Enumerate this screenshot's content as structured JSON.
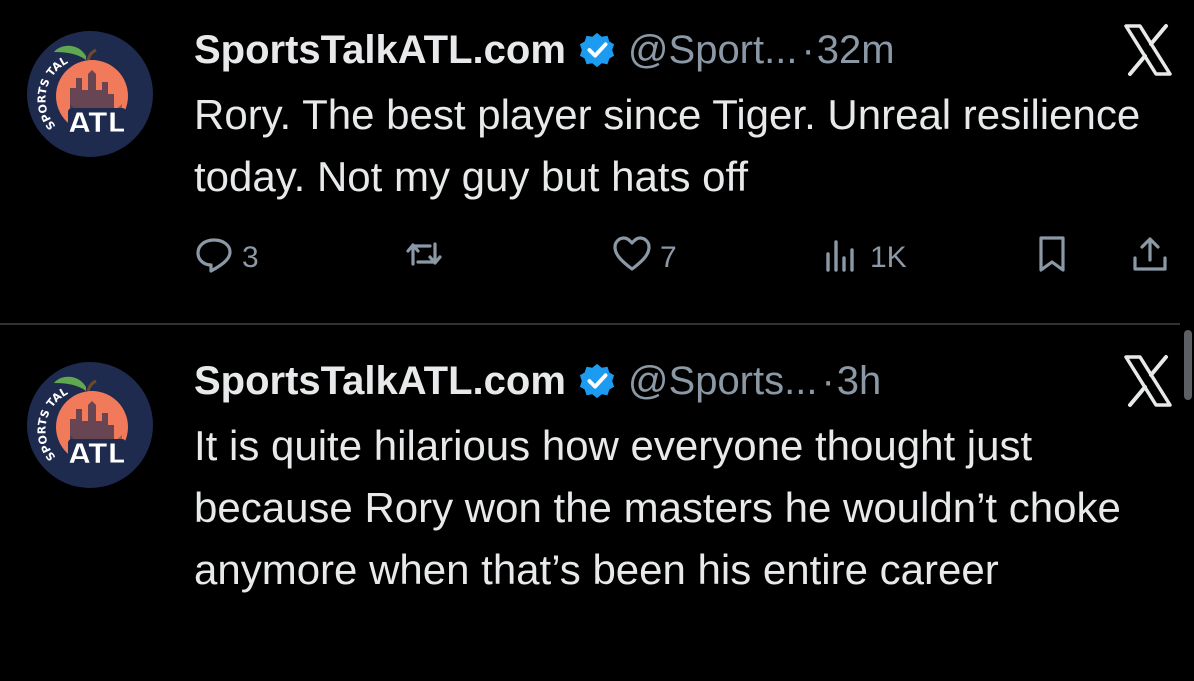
{
  "tweets": [
    {
      "author": {
        "display_name": "SportsTalkATL.com",
        "handle": "@Sport...",
        "verified": true
      },
      "separator": "·",
      "time": "32m",
      "text": "Rory. The best player since Tiger. Unreal resilience today. Not my guy but hats off",
      "metrics": {
        "replies": "3",
        "reposts": "",
        "likes": "7",
        "views": "1K"
      }
    },
    {
      "author": {
        "display_name": "SportsTalkATL.com",
        "handle": "@Sports...",
        "verified": true
      },
      "separator": "·",
      "time": "3h",
      "text": "It is quite hilarious how everyone thought just because Rory won the masters he wouldn’t choke anymore when that’s been his entire career"
    }
  ],
  "avatar": {
    "top_text": "SPORTS TALK",
    "main_text": "ATL"
  },
  "colors": {
    "background": "#000000",
    "text_primary": "#e7e9ea",
    "text_secondary": "#8b98a5",
    "verified_badge": "#1d9bf0",
    "avatar_bg": "#1f2a4f",
    "peach": "#f07a5a",
    "divider": "#2f3336"
  },
  "icons": [
    "verified-badge-icon",
    "x-logo-icon",
    "reply-icon",
    "repost-icon",
    "like-icon",
    "views-icon",
    "bookmark-icon",
    "share-icon"
  ]
}
